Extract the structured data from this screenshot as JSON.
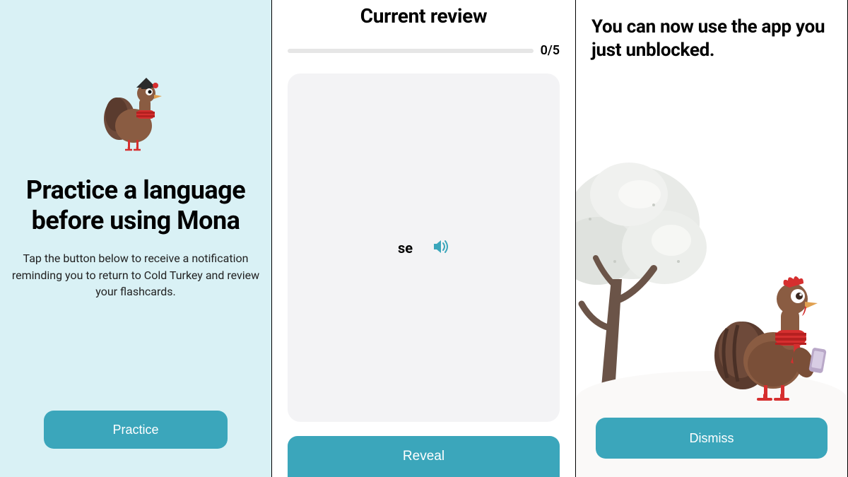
{
  "colors": {
    "accent": "#3ba6bb",
    "panel1_bg": "#d9f1f5",
    "card_bg": "#f3f3f5"
  },
  "panel1": {
    "title_line1": "Practice a language",
    "title_line2": "before using Mona",
    "description": "Tap the button below to receive a notification reminding you to return to Cold Turkey and review your flashcards.",
    "button_label": "Practice"
  },
  "panel2": {
    "title": "Current review",
    "progress": {
      "current": 0,
      "total": 5,
      "label": "0/5"
    },
    "card_word": "se",
    "speaker_icon": "speaker-icon",
    "button_label": "Reveal"
  },
  "panel3": {
    "title": "You can now use the app you just unblocked.",
    "button_label": "Dismiss"
  }
}
